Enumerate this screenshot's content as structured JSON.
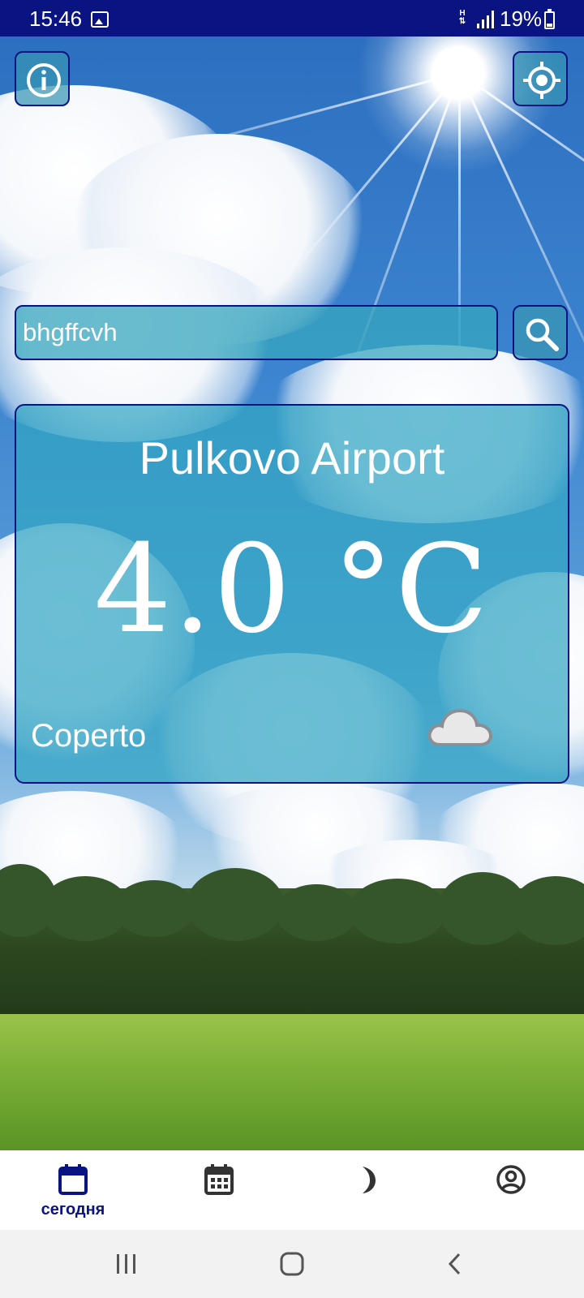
{
  "status_bar": {
    "time": "15:46",
    "network": "H",
    "battery": "19%"
  },
  "search": {
    "value": "bhgffcvh"
  },
  "weather": {
    "location": "Pulkovo Airport",
    "temperature": "4.0 °C",
    "condition": "Coperto",
    "condition_icon": "cloud-icon"
  },
  "bottom_nav": {
    "items": [
      {
        "label": "сегодня",
        "icon": "calendar-today-icon",
        "active": true
      },
      {
        "label": "",
        "icon": "calendar-grid-icon",
        "active": false
      },
      {
        "label": "",
        "icon": "moon-icon",
        "active": false
      },
      {
        "label": "",
        "icon": "account-icon",
        "active": false
      }
    ]
  },
  "colors": {
    "accent": "#0a1382",
    "card": "#32a5c3",
    "text": "#ffffff"
  }
}
